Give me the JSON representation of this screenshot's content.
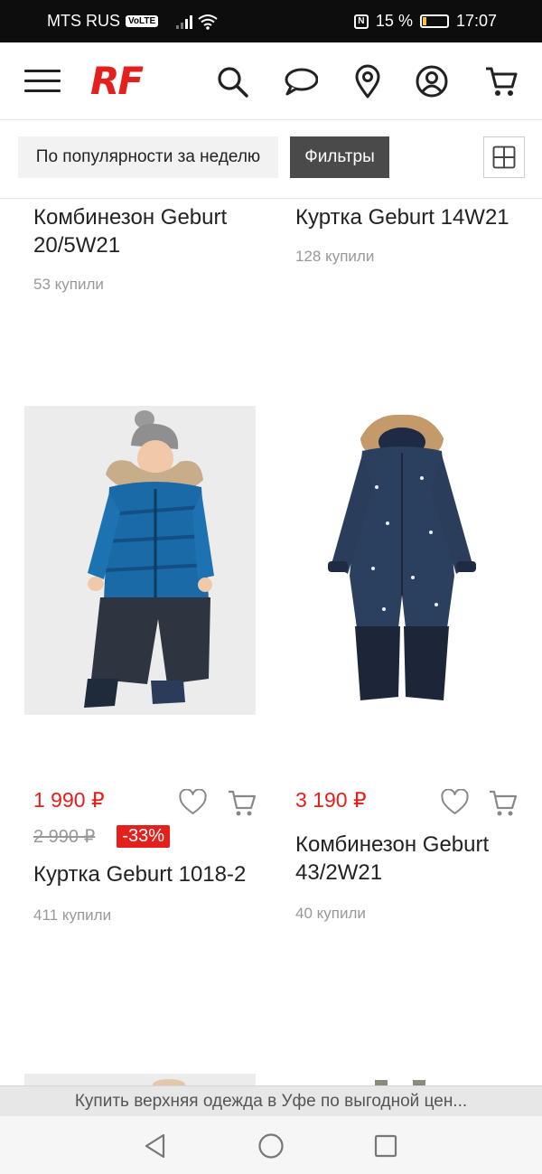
{
  "status_bar": {
    "carrier": "MTS RUS",
    "volte": "VoLTE",
    "battery_percent": "15 %",
    "battery_level": 0.15,
    "time": "17:07"
  },
  "header": {
    "logo": "RF",
    "icons": [
      "menu-icon",
      "search-icon",
      "chat-icon",
      "location-pin-icon",
      "account-icon",
      "cart-icon"
    ]
  },
  "toolbar": {
    "sort_label": "По популярности за неделю",
    "filter_label": "Фильтры"
  },
  "products": [
    {
      "name": "Комбинезон Geburt 20/5W21",
      "bought": "53 купили"
    },
    {
      "name": "Куртка Geburt 14W21",
      "bought": "128 купили"
    },
    {
      "price": "1 990 ₽",
      "old_price": "2 990 ₽",
      "discount": "-33%",
      "name": "Куртка Geburt 1018-2",
      "bought": "411 купили"
    },
    {
      "price": "3 190 ₽",
      "name": "Комбинезон Geburt 43/2W21",
      "bought": "40 купили"
    }
  ],
  "seo_bar": {
    "text": "Купить верхняя одежда в Уфе по выгодной цен..."
  },
  "colors": {
    "accent": "#e3201b",
    "filter_button": "#4a4a4a"
  }
}
